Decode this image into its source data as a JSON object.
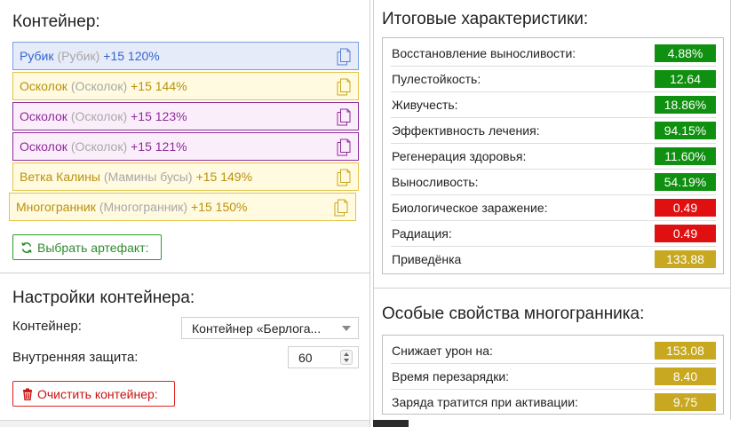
{
  "container": {
    "title": "Контейнер:",
    "artifacts": [
      {
        "name": "Рубик",
        "orig": "(Рубик)",
        "bonus": "+15 120%",
        "style": "blue"
      },
      {
        "name": "Осколок",
        "orig": "(Осколок)",
        "bonus": "+15 144%",
        "style": "yellow"
      },
      {
        "name": "Осколок",
        "orig": "(Осколок)",
        "bonus": "+15 123%",
        "style": "purple"
      },
      {
        "name": "Осколок",
        "orig": "(Осколок)",
        "bonus": "+15 121%",
        "style": "purple"
      },
      {
        "name": "Ветка Калины",
        "orig": "(Мамины бусы)",
        "bonus": "+15 149%",
        "style": "yellow"
      },
      {
        "name": "Многогранник",
        "orig": "(Многогранник)",
        "bonus": "+15 150%",
        "style": "yellow"
      }
    ],
    "choose_button": "Выбрать артефакт:"
  },
  "settings": {
    "title": "Настройки контейнера:",
    "container_label": "Контейнер:",
    "container_value": "Контейнер «Берлога...",
    "protection_label": "Внутренняя защита:",
    "protection_value": "60",
    "clear_button": "Очистить контейнер:"
  },
  "totals": {
    "title": "Итоговые характеристики:",
    "stats": [
      {
        "label": "Восстановление выносливости:",
        "value": "4.88%",
        "color": "green"
      },
      {
        "label": "Пулестойкость:",
        "value": "12.64",
        "color": "green"
      },
      {
        "label": "Живучесть:",
        "value": "18.86%",
        "color": "green"
      },
      {
        "label": "Эффективность лечения:",
        "value": "94.15%",
        "color": "green"
      },
      {
        "label": "Регенерация здоровья:",
        "value": "11.60%",
        "color": "green"
      },
      {
        "label": "Выносливость:",
        "value": "54.19%",
        "color": "green"
      },
      {
        "label": "Биологическое заражение:",
        "value": "0.49",
        "color": "red"
      },
      {
        "label": "Радиация:",
        "value": "0.49",
        "color": "red"
      },
      {
        "label": "Приведёнка",
        "value": "133.88",
        "color": "gold"
      }
    ]
  },
  "special": {
    "title": "Особые свойства многогранника:",
    "stats": [
      {
        "label": "Снижает урон на:",
        "value": "153.08",
        "color": "gold"
      },
      {
        "label": "Время перезарядки:",
        "value": "8.40",
        "color": "gold"
      },
      {
        "label": "Заряда тратится при активации:",
        "value": "9.75",
        "color": "gold"
      }
    ]
  },
  "icons": {
    "copy": "copy-icon",
    "refresh": "refresh-icon",
    "trash": "trash-icon"
  },
  "colors": {
    "green": "#109010",
    "red": "#e01010",
    "gold": "#c8a820"
  }
}
